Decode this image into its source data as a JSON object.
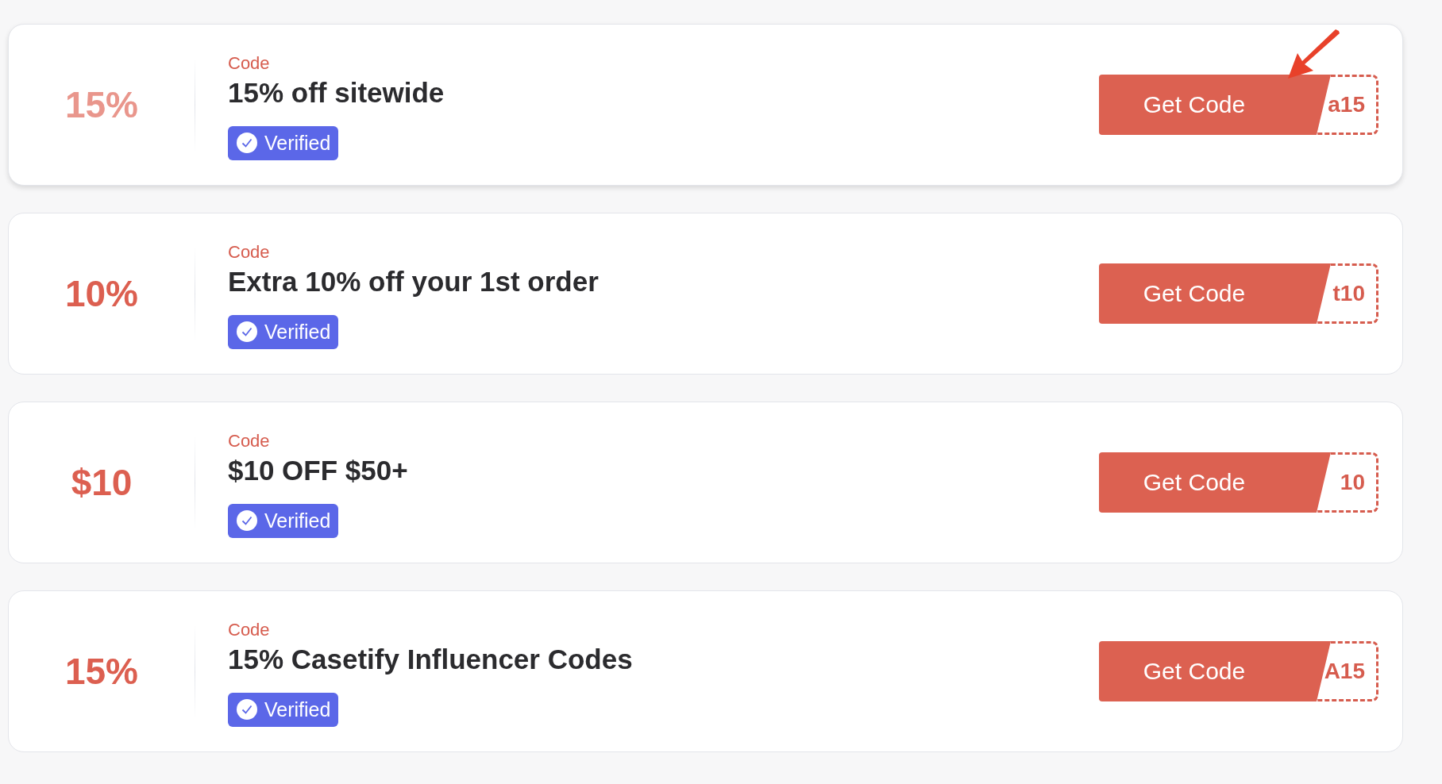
{
  "coupons": [
    {
      "discount": "15%",
      "type_label": "Code",
      "title": "15% off sitewide",
      "badge": "Verified",
      "button": "Get Code",
      "code_peek": "a15",
      "highlighted": true
    },
    {
      "discount": "10%",
      "type_label": "Code",
      "title": "Extra 10% off your 1st order",
      "badge": "Verified",
      "button": "Get Code",
      "code_peek": "t10",
      "highlighted": false
    },
    {
      "discount": "$10",
      "type_label": "Code",
      "title": "$10 OFF $50+",
      "badge": "Verified",
      "button": "Get Code",
      "code_peek": "10",
      "highlighted": false
    },
    {
      "discount": "15%",
      "type_label": "Code",
      "title": "15% Casetify Influencer Codes",
      "badge": "Verified",
      "button": "Get Code",
      "code_peek": "A15",
      "highlighted": false
    }
  ]
}
